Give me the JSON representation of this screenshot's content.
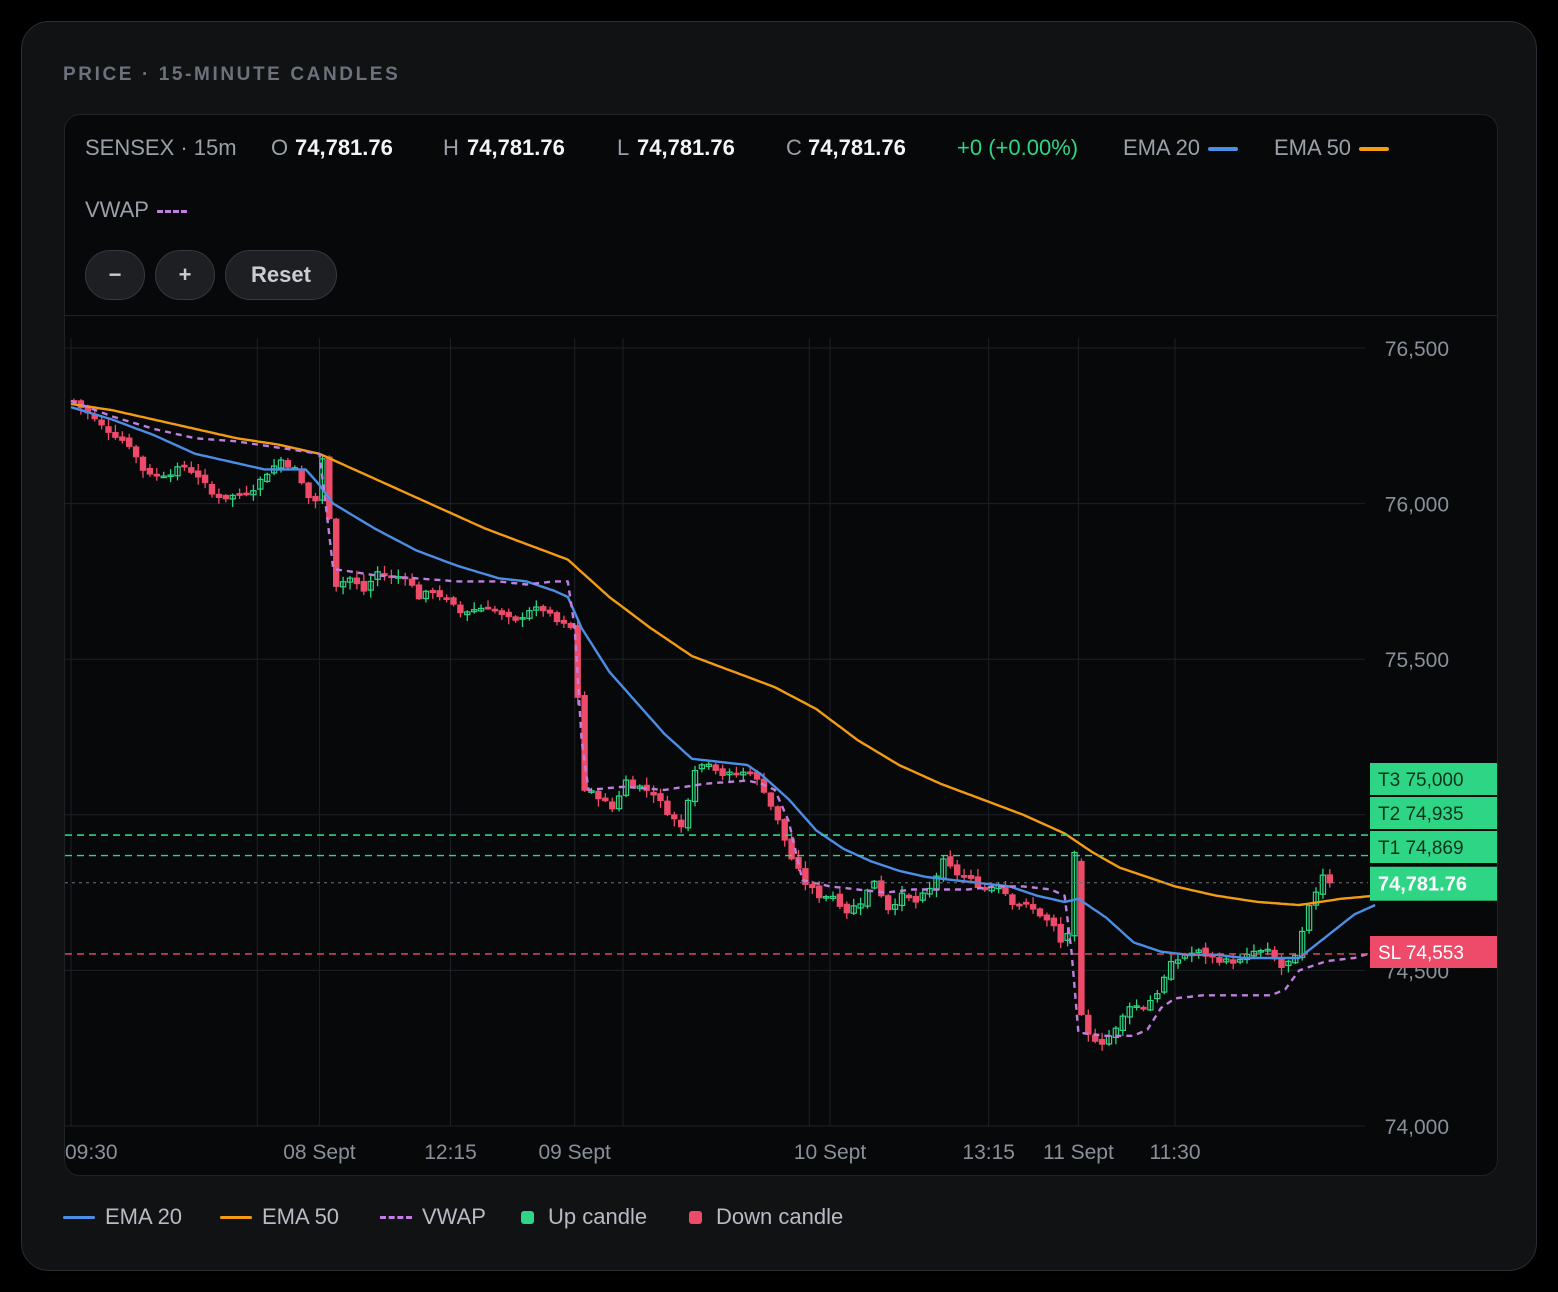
{
  "section_title": "PRICE · 15-MINUTE CANDLES",
  "header": {
    "symbol": "SENSEX · 15m",
    "o_label": "O",
    "o_value": "74,781.76",
    "h_label": "H",
    "h_value": "74,781.76",
    "l_label": "L",
    "l_value": "74,781.76",
    "c_label": "C",
    "c_value": "74,781.76",
    "change": "+0 (+0.00%)",
    "ema20_label": "EMA 20",
    "ema50_label": "EMA 50",
    "vwap_label": "VWAP"
  },
  "controls": {
    "zoom_out": "−",
    "zoom_in": "+",
    "reset": "Reset"
  },
  "legend": {
    "ema20": "EMA 20",
    "ema50": "EMA 50",
    "vwap": "VWAP",
    "up": "Up candle",
    "down": "Down candle"
  },
  "colors": {
    "up": "#2ed584",
    "down": "#ee4b6a",
    "ema20": "#4c8ee6",
    "ema50": "#f39c12",
    "vwap": "#c07ee0",
    "grid": "#1d2026",
    "axis_text": "#8a9099",
    "background": "#07080a"
  },
  "chart_data": {
    "type": "candlestick",
    "y_axis": {
      "ticks": [
        74000,
        74500,
        75000,
        75500,
        76000,
        76500
      ],
      "tick_labels": [
        "74,000",
        "74,500",
        "",
        "75,500",
        "76,000",
        "76,500"
      ],
      "range": [
        74000,
        76500
      ],
      "position": "right"
    },
    "x_axis": {
      "labels": [
        "09:30",
        "08 Sept",
        "12:15",
        "09 Sept",
        "10 Sept",
        "13:15",
        "11 Sept",
        "11:30"
      ],
      "label_index": [
        0,
        36,
        55,
        73,
        110,
        133,
        146,
        160
      ],
      "extra_grid_index": [
        27,
        80,
        107
      ]
    },
    "candle_count": 183,
    "last_price": 74781.76,
    "last_price_label": "74,781.76",
    "levels": [
      {
        "label": "T3 75,000",
        "price": 75000,
        "kind": "target"
      },
      {
        "label": "T2 74,935",
        "price": 74935,
        "kind": "target"
      },
      {
        "label": "T1 74,869",
        "price": 74869,
        "kind": "target"
      },
      {
        "label": "SL 74,553",
        "price": 74553,
        "kind": "stop"
      }
    ],
    "close_anchors": [
      [
        0,
        76330
      ],
      [
        2,
        76290
      ],
      [
        4,
        76250
      ],
      [
        6,
        76220
      ],
      [
        8,
        76190
      ],
      [
        10,
        76110
      ],
      [
        12,
        76090
      ],
      [
        14,
        76100
      ],
      [
        16,
        76120
      ],
      [
        18,
        76090
      ],
      [
        20,
        76030
      ],
      [
        22,
        76020
      ],
      [
        24,
        76030
      ],
      [
        26,
        76050
      ],
      [
        28,
        76100
      ],
      [
        30,
        76140
      ],
      [
        32,
        76110
      ],
      [
        34,
        76020
      ],
      [
        35,
        76010
      ],
      [
        36,
        76140
      ],
      [
        37,
        75960
      ],
      [
        38,
        75740
      ],
      [
        40,
        75760
      ],
      [
        42,
        75720
      ],
      [
        44,
        75780
      ],
      [
        46,
        75760
      ],
      [
        48,
        75770
      ],
      [
        50,
        75700
      ],
      [
        52,
        75720
      ],
      [
        54,
        75690
      ],
      [
        56,
        75650
      ],
      [
        58,
        75660
      ],
      [
        60,
        75670
      ],
      [
        62,
        75640
      ],
      [
        64,
        75620
      ],
      [
        66,
        75660
      ],
      [
        68,
        75660
      ],
      [
        70,
        75620
      ],
      [
        72,
        75600
      ],
      [
        73,
        75380
      ],
      [
        74,
        75080
      ],
      [
        76,
        75060
      ],
      [
        78,
        75020
      ],
      [
        80,
        75110
      ],
      [
        82,
        75090
      ],
      [
        84,
        75070
      ],
      [
        86,
        75010
      ],
      [
        88,
        74960
      ],
      [
        90,
        75150
      ],
      [
        92,
        75170
      ],
      [
        94,
        75130
      ],
      [
        96,
        75130
      ],
      [
        98,
        75140
      ],
      [
        100,
        75080
      ],
      [
        102,
        74980
      ],
      [
        104,
        74860
      ],
      [
        106,
        74780
      ],
      [
        108,
        74740
      ],
      [
        110,
        74740
      ],
      [
        112,
        74690
      ],
      [
        114,
        74720
      ],
      [
        116,
        74790
      ],
      [
        118,
        74700
      ],
      [
        120,
        74740
      ],
      [
        122,
        74720
      ],
      [
        124,
        74760
      ],
      [
        126,
        74850
      ],
      [
        128,
        74810
      ],
      [
        130,
        74790
      ],
      [
        132,
        74760
      ],
      [
        134,
        74780
      ],
      [
        136,
        74720
      ],
      [
        138,
        74710
      ],
      [
        140,
        74680
      ],
      [
        142,
        74640
      ],
      [
        143,
        74590
      ],
      [
        144,
        74620
      ],
      [
        145,
        74870
      ],
      [
        146,
        74350
      ],
      [
        147,
        74290
      ],
      [
        149,
        74270
      ],
      [
        151,
        74310
      ],
      [
        153,
        74390
      ],
      [
        155,
        74380
      ],
      [
        157,
        74430
      ],
      [
        159,
        74520
      ],
      [
        161,
        74550
      ],
      [
        163,
        74560
      ],
      [
        165,
        74540
      ],
      [
        167,
        74530
      ],
      [
        169,
        74530
      ],
      [
        171,
        74560
      ],
      [
        173,
        74560
      ],
      [
        175,
        74510
      ],
      [
        177,
        74540
      ],
      [
        179,
        74700
      ],
      [
        181,
        74810
      ],
      [
        182,
        74781.76
      ]
    ],
    "ema20_anchors": [
      [
        0,
        76310
      ],
      [
        6,
        76270
      ],
      [
        12,
        76220
      ],
      [
        18,
        76160
      ],
      [
        24,
        76130
      ],
      [
        28,
        76110
      ],
      [
        34,
        76110
      ],
      [
        36,
        76060
      ],
      [
        38,
        76000
      ],
      [
        44,
        75920
      ],
      [
        50,
        75850
      ],
      [
        56,
        75800
      ],
      [
        62,
        75760
      ],
      [
        66,
        75750
      ],
      [
        70,
        75720
      ],
      [
        72,
        75700
      ],
      [
        74,
        75600
      ],
      [
        78,
        75460
      ],
      [
        82,
        75360
      ],
      [
        86,
        75260
      ],
      [
        90,
        75180
      ],
      [
        94,
        75170
      ],
      [
        98,
        75160
      ],
      [
        100,
        75130
      ],
      [
        104,
        75050
      ],
      [
        108,
        74950
      ],
      [
        112,
        74890
      ],
      [
        116,
        74850
      ],
      [
        120,
        74820
      ],
      [
        124,
        74800
      ],
      [
        128,
        74790
      ],
      [
        132,
        74780
      ],
      [
        136,
        74770
      ],
      [
        140,
        74740
      ],
      [
        144,
        74720
      ],
      [
        146,
        74730
      ],
      [
        150,
        74670
      ],
      [
        154,
        74590
      ],
      [
        158,
        74560
      ],
      [
        162,
        74550
      ],
      [
        166,
        74550
      ],
      [
        170,
        74540
      ],
      [
        174,
        74540
      ],
      [
        178,
        74540
      ],
      [
        182,
        74610
      ],
      [
        186,
        74680
      ],
      [
        189,
        74710
      ]
    ],
    "ema50_anchors": [
      [
        0,
        76320
      ],
      [
        6,
        76300
      ],
      [
        12,
        76270
      ],
      [
        18,
        76240
      ],
      [
        24,
        76210
      ],
      [
        30,
        76190
      ],
      [
        36,
        76160
      ],
      [
        42,
        76100
      ],
      [
        48,
        76040
      ],
      [
        54,
        75980
      ],
      [
        60,
        75920
      ],
      [
        66,
        75870
      ],
      [
        72,
        75820
      ],
      [
        78,
        75700
      ],
      [
        84,
        75600
      ],
      [
        90,
        75510
      ],
      [
        96,
        75460
      ],
      [
        102,
        75410
      ],
      [
        108,
        75340
      ],
      [
        114,
        75240
      ],
      [
        120,
        75160
      ],
      [
        126,
        75100
      ],
      [
        132,
        75050
      ],
      [
        138,
        75000
      ],
      [
        144,
        74940
      ],
      [
        148,
        74880
      ],
      [
        152,
        74830
      ],
      [
        156,
        74800
      ],
      [
        160,
        74770
      ],
      [
        166,
        74740
      ],
      [
        172,
        74720
      ],
      [
        178,
        74710
      ],
      [
        184,
        74730
      ],
      [
        189,
        74740
      ]
    ],
    "vwap_anchors": [
      [
        0,
        76330
      ],
      [
        6,
        76280
      ],
      [
        12,
        76240
      ],
      [
        18,
        76210
      ],
      [
        24,
        76200
      ],
      [
        30,
        76180
      ],
      [
        36,
        76160
      ],
      [
        37,
        75980
      ],
      [
        38,
        75790
      ],
      [
        44,
        75770
      ],
      [
        50,
        75760
      ],
      [
        56,
        75750
      ],
      [
        62,
        75750
      ],
      [
        66,
        75740
      ],
      [
        70,
        75750
      ],
      [
        72,
        75750
      ],
      [
        73,
        75600
      ],
      [
        74,
        75240
      ],
      [
        75,
        75080
      ],
      [
        80,
        75090
      ],
      [
        86,
        75080
      ],
      [
        92,
        75100
      ],
      [
        98,
        75110
      ],
      [
        100,
        75100
      ],
      [
        102,
        75080
      ],
      [
        104,
        74980
      ],
      [
        106,
        74790
      ],
      [
        110,
        74770
      ],
      [
        114,
        74760
      ],
      [
        118,
        74750
      ],
      [
        122,
        74760
      ],
      [
        126,
        74760
      ],
      [
        130,
        74760
      ],
      [
        134,
        74770
      ],
      [
        138,
        74770
      ],
      [
        142,
        74760
      ],
      [
        144,
        74740
      ],
      [
        145,
        74560
      ],
      [
        146,
        74300
      ],
      [
        150,
        74290
      ],
      [
        154,
        74290
      ],
      [
        156,
        74310
      ],
      [
        158,
        74380
      ],
      [
        160,
        74410
      ],
      [
        164,
        74420
      ],
      [
        170,
        74420
      ],
      [
        174,
        74420
      ],
      [
        176,
        74440
      ],
      [
        178,
        74500
      ],
      [
        182,
        74530
      ],
      [
        186,
        74540
      ],
      [
        189,
        74560
      ]
    ]
  }
}
